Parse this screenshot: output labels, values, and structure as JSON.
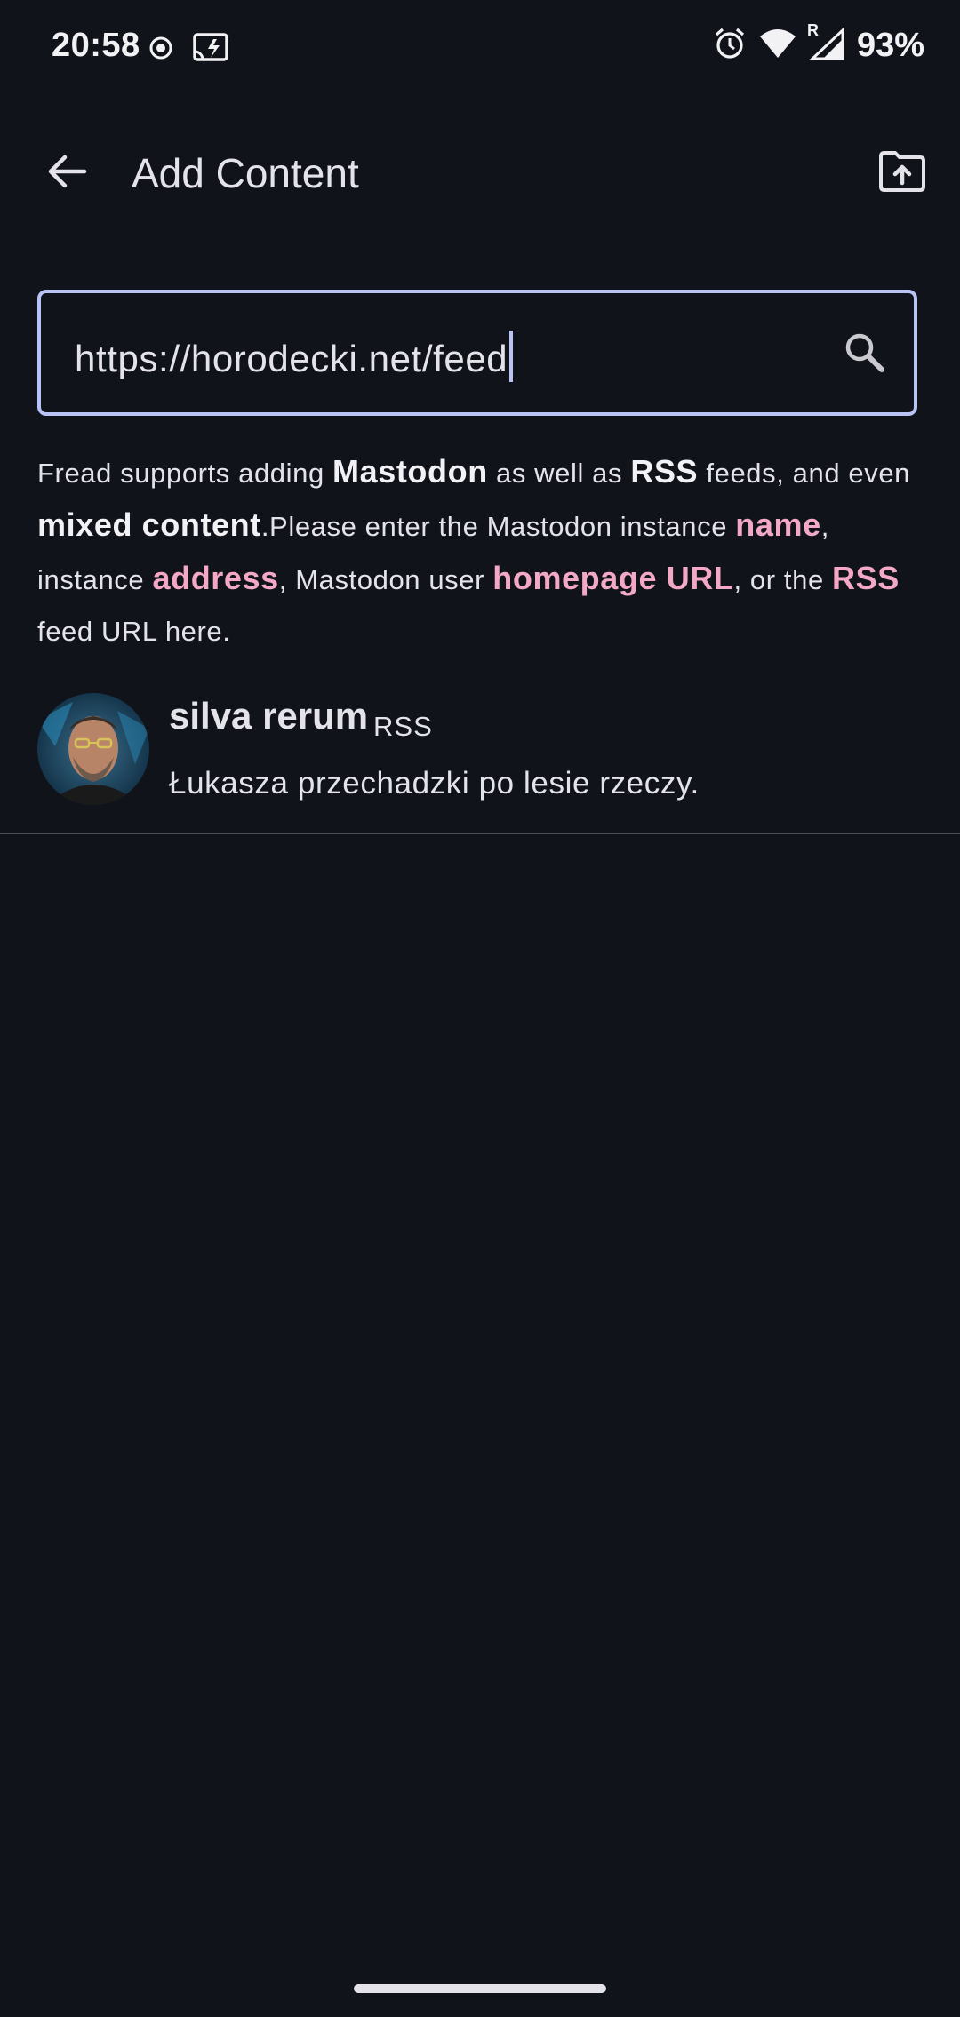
{
  "status_bar": {
    "time": "20:58",
    "battery": "93%",
    "icons_left": [
      "record-icon",
      "screencast-icon"
    ],
    "icons_right": [
      "alarm-icon",
      "wifi-icon",
      "signal-icon"
    ],
    "roaming_indicator": "R"
  },
  "app_bar": {
    "title": "Add Content",
    "back_icon": "arrow-back-icon",
    "upload_icon": "folder-upload-icon"
  },
  "search": {
    "value": "https://horodecki.net/feed",
    "icon": "search-icon"
  },
  "help": {
    "p1": "Fread supports adding ",
    "mastodon": "Mastodon",
    "p2": " as well as ",
    "rss": "RSS",
    "p3": " feeds, and even ",
    "mixed": "mixed content",
    "p4": ".Please enter the Mastodon instance ",
    "name": "name",
    "p5": ", instance ",
    "address": "address",
    "p6": ", Mastodon user ",
    "homepage": "homepage URL",
    "p7": ", or the ",
    "rss2": "RSS",
    "p8": " feed URL here."
  },
  "results": [
    {
      "title": "silva rerum",
      "badge": "RSS",
      "description": "Łukasza przechadzki po lesie rzeczy."
    }
  ],
  "colors": {
    "background": "#11131b",
    "accent": "#b9c3f4",
    "highlight_pink": "#f3a9c6",
    "text": "#e4e3ea"
  }
}
